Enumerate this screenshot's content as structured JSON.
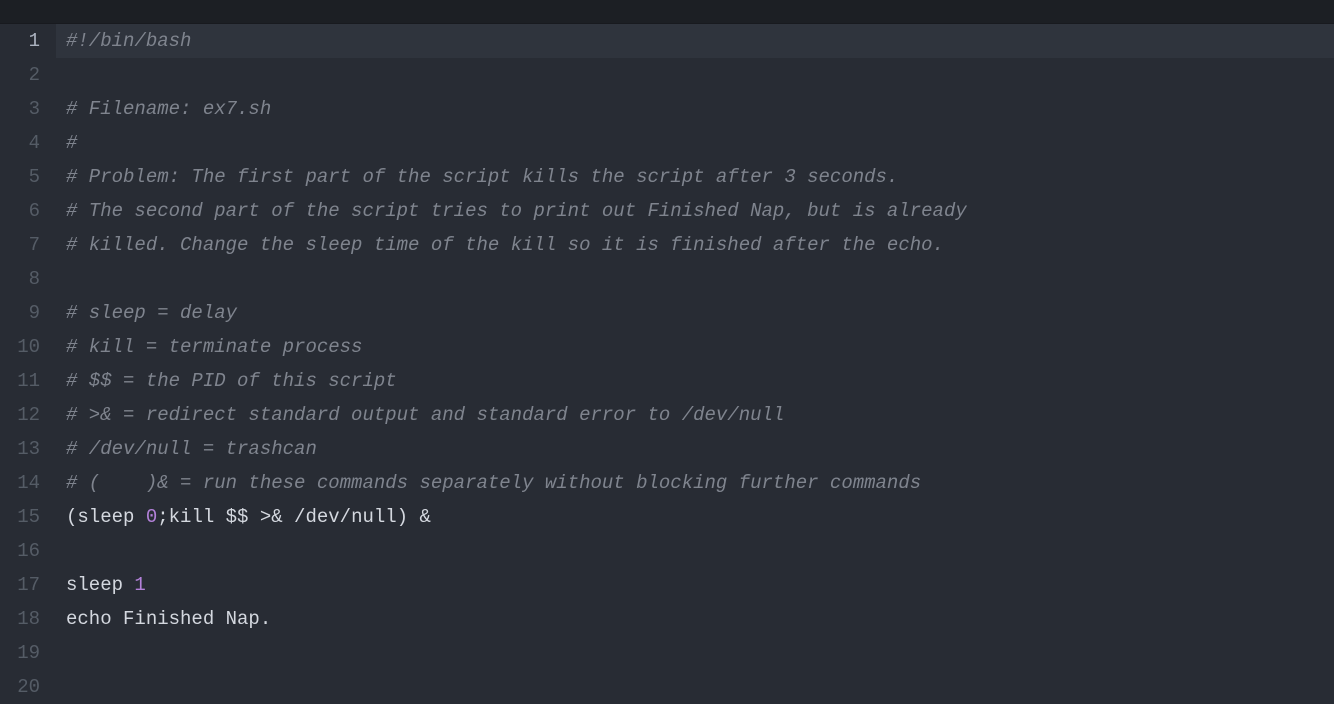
{
  "editor": {
    "active_line": 1,
    "lines": [
      {
        "num": 1,
        "highlighted": true,
        "tokens": [
          {
            "cls": "comment",
            "t": "#!/bin/bash"
          }
        ]
      },
      {
        "num": 2,
        "tokens": []
      },
      {
        "num": 3,
        "tokens": [
          {
            "cls": "comment",
            "t": "# Filename: ex7.sh"
          }
        ]
      },
      {
        "num": 4,
        "tokens": [
          {
            "cls": "comment",
            "t": "#"
          }
        ]
      },
      {
        "num": 5,
        "tokens": [
          {
            "cls": "comment",
            "t": "# Problem: The first part of the script kills the script after 3 seconds."
          }
        ]
      },
      {
        "num": 6,
        "tokens": [
          {
            "cls": "comment",
            "t": "# The second part of the script tries to print out Finished Nap, but is already"
          }
        ]
      },
      {
        "num": 7,
        "tokens": [
          {
            "cls": "comment",
            "t": "# killed. Change the sleep time of the kill so it is finished after the echo."
          }
        ]
      },
      {
        "num": 8,
        "tokens": []
      },
      {
        "num": 9,
        "tokens": [
          {
            "cls": "comment",
            "t": "# sleep = delay"
          }
        ]
      },
      {
        "num": 10,
        "tokens": [
          {
            "cls": "comment",
            "t": "# kill = terminate process"
          }
        ]
      },
      {
        "num": 11,
        "tokens": [
          {
            "cls": "comment",
            "t": "# $$ = the PID of this script"
          }
        ]
      },
      {
        "num": 12,
        "tokens": [
          {
            "cls": "comment",
            "t": "# >& = redirect standard output and standard error to /dev/null"
          }
        ]
      },
      {
        "num": 13,
        "tokens": [
          {
            "cls": "comment",
            "t": "# /dev/null = trashcan"
          }
        ]
      },
      {
        "num": 14,
        "tokens": [
          {
            "cls": "comment",
            "t": "# (    )& = run these commands separately without blocking further commands"
          }
        ]
      },
      {
        "num": 15,
        "tokens": [
          {
            "cls": "plain",
            "t": "(sleep "
          },
          {
            "cls": "number",
            "t": "0"
          },
          {
            "cls": "plain",
            "t": ";kill $$ >& /dev/null) &"
          }
        ]
      },
      {
        "num": 16,
        "tokens": []
      },
      {
        "num": 17,
        "tokens": [
          {
            "cls": "plain",
            "t": "sleep "
          },
          {
            "cls": "number",
            "t": "1"
          }
        ]
      },
      {
        "num": 18,
        "tokens": [
          {
            "cls": "fn",
            "t": "echo"
          },
          {
            "cls": "plain",
            "t": " Finished Nap."
          }
        ]
      },
      {
        "num": 19,
        "tokens": []
      },
      {
        "num": 20,
        "tokens": []
      }
    ]
  }
}
